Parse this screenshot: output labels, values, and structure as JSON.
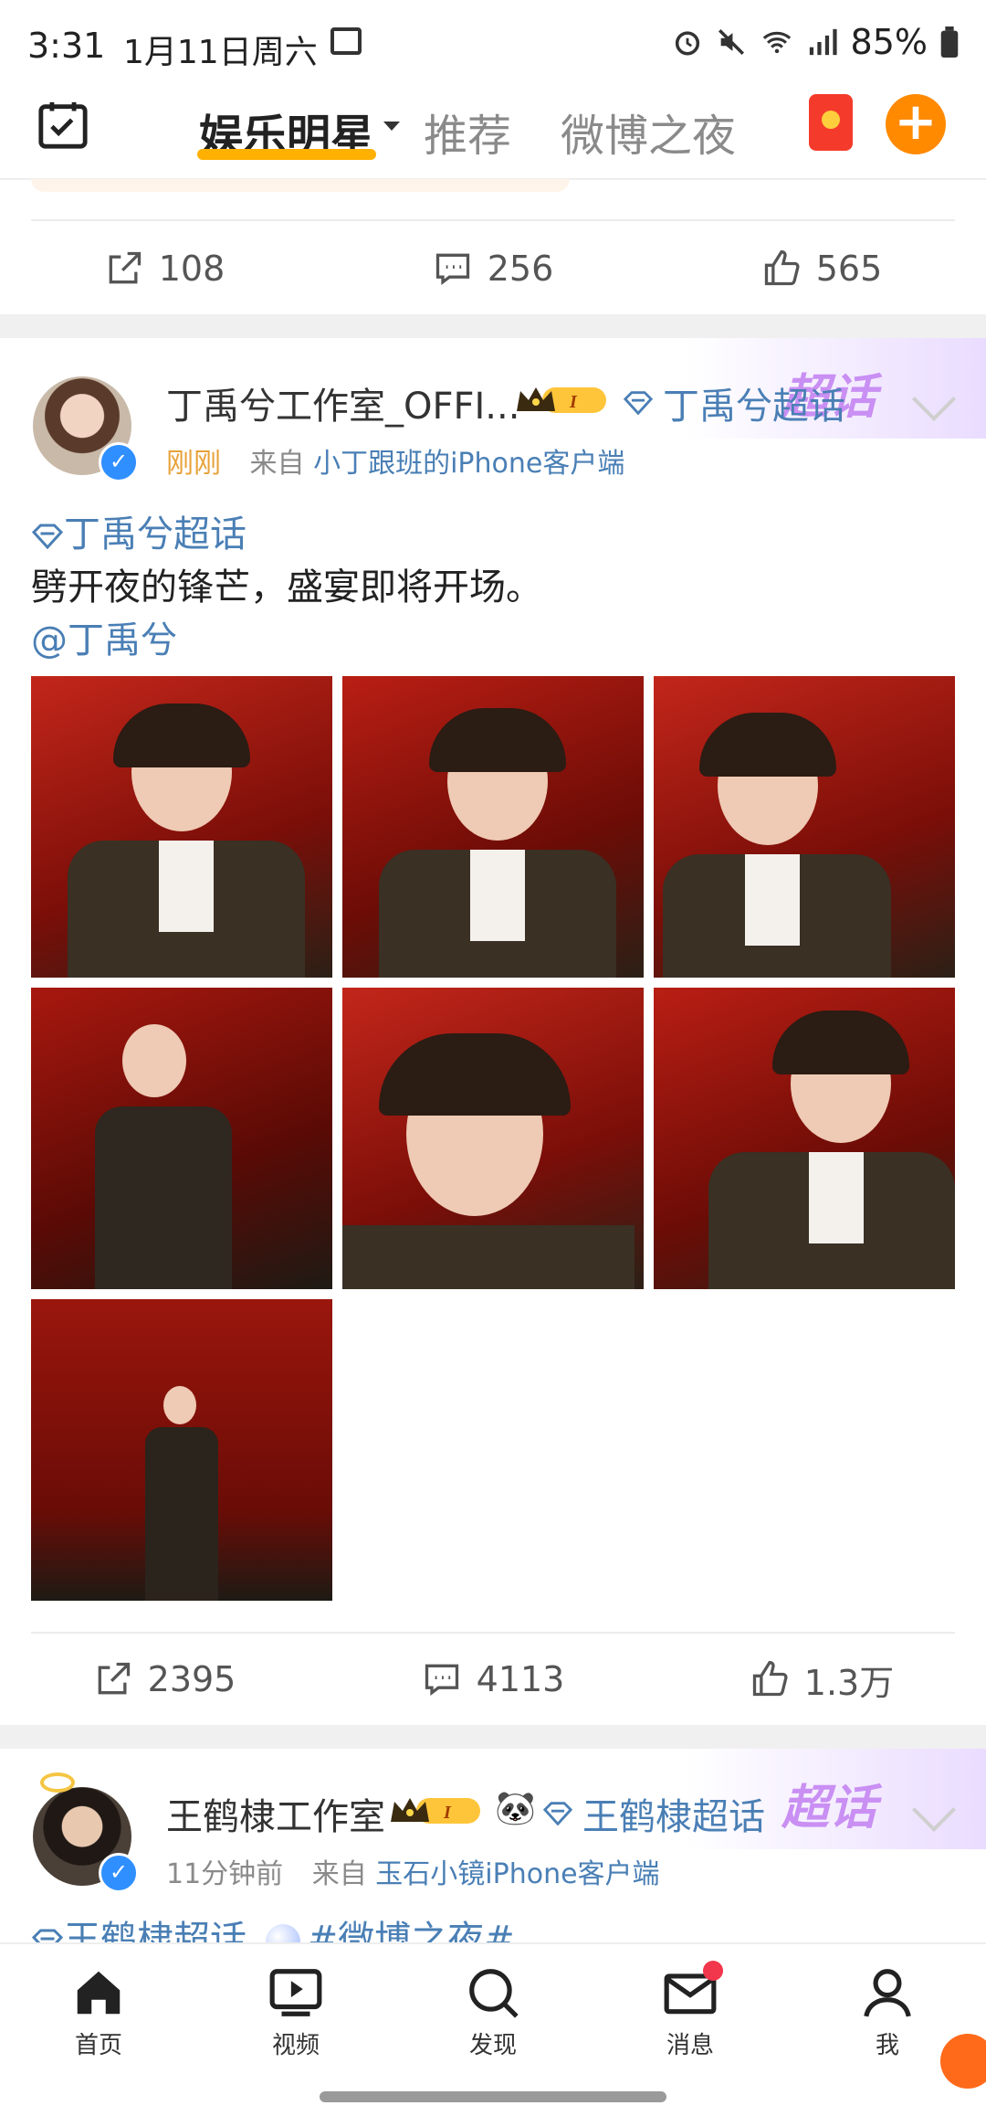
{
  "status_bar": {
    "time": "3:31",
    "date": "1月11日周六",
    "battery": "85%"
  },
  "top_nav": {
    "tabs": [
      {
        "label": "娱乐明星",
        "active": true
      },
      {
        "label": "推荐",
        "active": false
      },
      {
        "label": "微博之夜",
        "active": false
      }
    ]
  },
  "post_prev": {
    "reposts": "108",
    "comments": "256",
    "likes": "565"
  },
  "post1": {
    "username": "丁禹兮工作室_OFFI...",
    "topic": "丁禹兮超话",
    "time": "刚刚",
    "source_prefix": "来自",
    "source": "小丁跟班的iPhone客户端",
    "chaohua_label": "超话",
    "tag": "丁禹兮超话",
    "text": "劈开夜的锋芒，盛宴即将开场。",
    "mention": "@丁禹兮",
    "reposts": "2395",
    "comments": "4113",
    "likes": "1.3万"
  },
  "post2": {
    "username": "王鹤棣工作室",
    "topic": "王鹤棣超话",
    "time": "11分钟前",
    "source_prefix": "来自",
    "source": "玉石小镜iPhone客户端",
    "chaohua_label": "超话",
    "tag": "王鹤棣超话",
    "hashtag": "#微博之夜#"
  },
  "bottom_nav": {
    "items": [
      {
        "label": "首页"
      },
      {
        "label": "视频"
      },
      {
        "label": "发现"
      },
      {
        "label": "消息"
      },
      {
        "label": "我"
      }
    ]
  },
  "colors": {
    "accent": "#ff8a00",
    "link": "#4a7fb5",
    "tab_underline": "#ffb000",
    "verified": "#2f8fff"
  }
}
